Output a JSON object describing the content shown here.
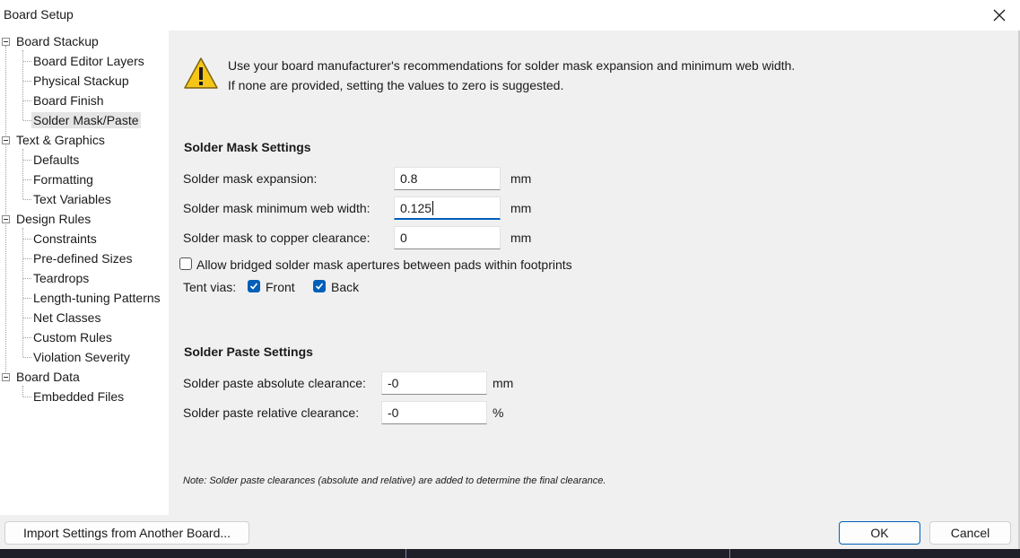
{
  "window": {
    "title": "Board Setup"
  },
  "tree": {
    "board_stackup": "Board Stackup",
    "board_editor_layers": "Board Editor Layers",
    "physical_stackup": "Physical Stackup",
    "board_finish": "Board Finish",
    "solder_mask_paste": "Solder Mask/Paste",
    "text_graphics": "Text & Graphics",
    "defaults": "Defaults",
    "formatting": "Formatting",
    "text_variables": "Text Variables",
    "design_rules": "Design Rules",
    "constraints": "Constraints",
    "predefined_sizes": "Pre-defined Sizes",
    "teardrops": "Teardrops",
    "length_tuning": "Length-tuning Patterns",
    "net_classes": "Net Classes",
    "custom_rules": "Custom Rules",
    "violation_severity": "Violation Severity",
    "board_data": "Board Data",
    "embedded_files": "Embedded Files"
  },
  "warning": {
    "line1": "Use your board manufacturer's recommendations for solder mask expansion and minimum web width.",
    "line2": "If none are provided, setting the values to zero is suggested."
  },
  "mask": {
    "title": "Solder Mask Settings",
    "expansion_label": "Solder mask expansion:",
    "expansion_value": "0.8",
    "expansion_unit": "mm",
    "web_label": "Solder mask minimum web width:",
    "web_value": "0.125",
    "web_unit": "mm",
    "copper_label": "Solder mask to copper clearance:",
    "copper_value": "0",
    "copper_unit": "mm",
    "bridged_label": "Allow bridged solder mask apertures between pads within footprints",
    "bridged_checked": false,
    "tent_label": "Tent vias:",
    "front_label": "Front",
    "front_checked": true,
    "back_label": "Back",
    "back_checked": true
  },
  "paste": {
    "title": "Solder Paste Settings",
    "abs_label": "Solder paste absolute clearance:",
    "abs_value": "-0",
    "abs_unit": "mm",
    "rel_label": "Solder paste relative clearance:",
    "rel_value": "-0",
    "rel_unit": "%"
  },
  "note": "Note: Solder paste clearances (absolute and relative) are added to determine the final clearance.",
  "buttons": {
    "import": "Import Settings from Another Board...",
    "ok": "OK",
    "cancel": "Cancel"
  },
  "colors": {
    "accent": "#005fb8",
    "warning_yellow": "#f5c518"
  }
}
